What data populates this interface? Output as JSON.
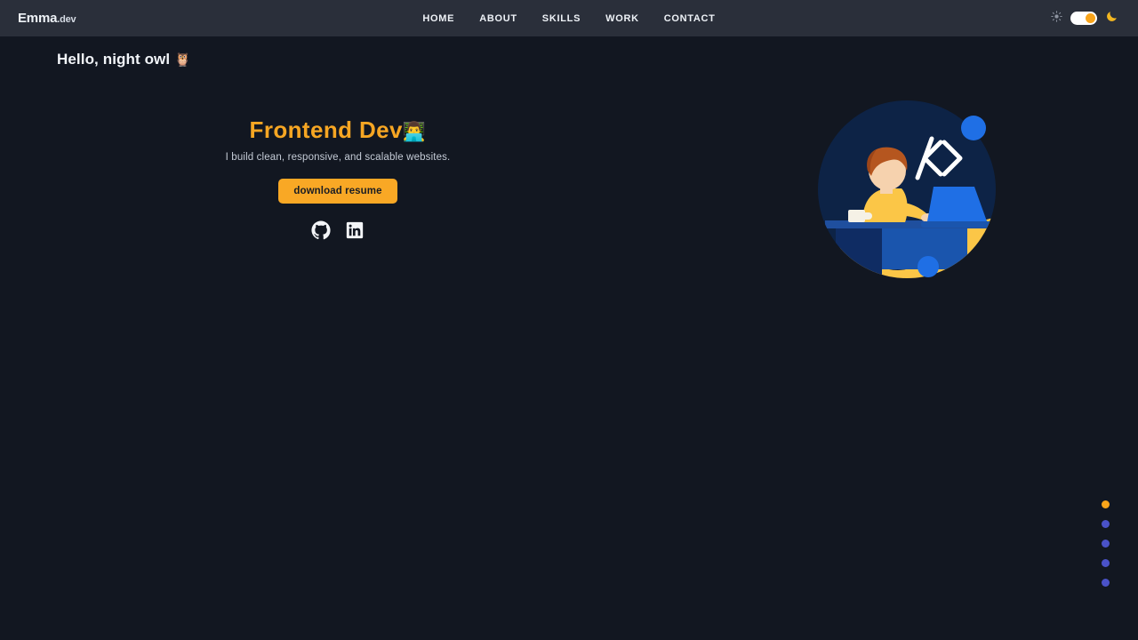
{
  "theme": {
    "mode": "dark",
    "header_bg": "#2a2f3a",
    "page_bg": "#121721",
    "accent": "#f9a825",
    "dot_active": "#f9a51a",
    "dot_inactive": "#4a52c8",
    "illustration_navy": "#0f2347",
    "illustration_yellow": "#fbc647",
    "illustration_blue": "#1f6fe5"
  },
  "header": {
    "brand_name": "Emma",
    "brand_suffix": ".dev",
    "nav_items": [
      {
        "label": "HOME",
        "icon": "home-nav-item"
      },
      {
        "label": "ABOUT",
        "icon": "about-nav-item"
      },
      {
        "label": "SKILLS",
        "icon": "skills-nav-item"
      },
      {
        "label": "WORK",
        "icon": "work-nav-item"
      },
      {
        "label": "CONTACT",
        "icon": "contact-nav-item"
      }
    ],
    "theme_toggle": {
      "sun_icon": "sun-icon",
      "moon_icon": "moon-icon",
      "state": "dark",
      "knob_position": "right"
    }
  },
  "greeting": {
    "text": "Hello, night owl",
    "emoji": "🦉"
  },
  "hero": {
    "title": "Frontend Dev",
    "title_emoji": "👨‍💻",
    "subtitle": "I build clean, responsive, and scalable websites.",
    "cta_label": "download resume",
    "socials": [
      {
        "name": "github",
        "icon": "github-icon"
      },
      {
        "name": "linkedin",
        "icon": "linkedin-icon"
      }
    ],
    "illustration": {
      "alt": "developer coding at laptop illustration",
      "code_symbol": "</>"
    }
  },
  "dot_nav": {
    "dots": [
      {
        "index": 1,
        "active": true
      },
      {
        "index": 2,
        "active": false
      },
      {
        "index": 3,
        "active": false
      },
      {
        "index": 4,
        "active": false
      },
      {
        "index": 5,
        "active": false
      }
    ]
  }
}
